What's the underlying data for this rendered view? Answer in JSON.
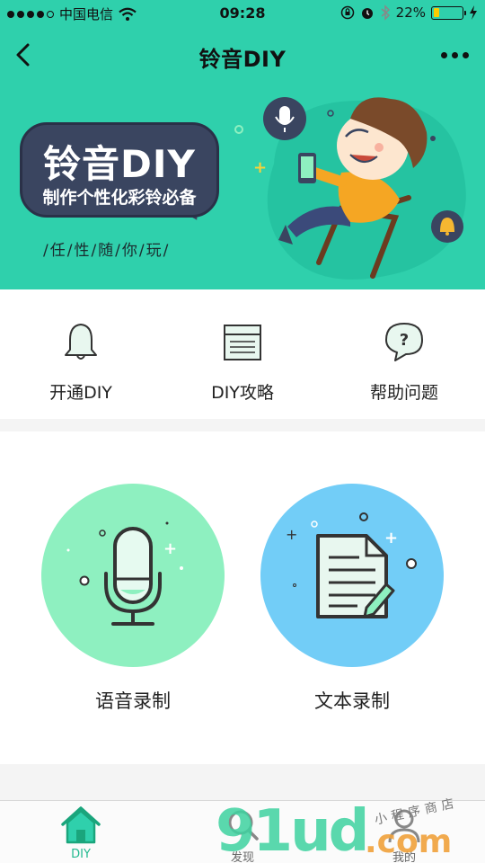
{
  "status_bar": {
    "carrier": "中国电信",
    "time": "09:28",
    "battery": "22%",
    "battery_level": 0.22,
    "icons": [
      "signal-dots-icon",
      "wifi-icon",
      "orientation-lock-icon",
      "alarm-icon",
      "bluetooth-icon",
      "battery-icon",
      "charging-icon"
    ]
  },
  "nav": {
    "title": "铃音DIY",
    "back_icon": "chevron-left-icon",
    "more_icon": "more-dots-icon"
  },
  "banner": {
    "title": "铃音DIY",
    "subtitle": "制作个性化彩铃必备",
    "slogan": "/任/性/随/你/玩/"
  },
  "quick_menu": [
    {
      "label": "开通DIY",
      "icon": "bell-icon"
    },
    {
      "label": "DIY攻略",
      "icon": "guide-document-icon"
    },
    {
      "label": "帮助问题",
      "icon": "help-question-icon"
    }
  ],
  "record_options": [
    {
      "label": "语音录制",
      "icon": "microphone-icon",
      "color": "#8ef0c0"
    },
    {
      "label": "文本录制",
      "icon": "document-edit-icon",
      "color": "#72cdf7"
    }
  ],
  "tab_bar": [
    {
      "label": "DIY",
      "icon": "home-icon",
      "active": true
    },
    {
      "label": "发现",
      "icon": "search-icon",
      "active": false
    },
    {
      "label": "我的",
      "icon": "user-icon",
      "active": false
    }
  ],
  "watermark": {
    "main": "91ud",
    "suffix": ".com",
    "small": "小程序商店"
  },
  "colors": {
    "brand": "#2fd0ac",
    "active_tab": "#22b98f",
    "voice_circle": "#8ef0c0",
    "text_circle": "#72cdf7",
    "bubble": "#3a4560"
  }
}
